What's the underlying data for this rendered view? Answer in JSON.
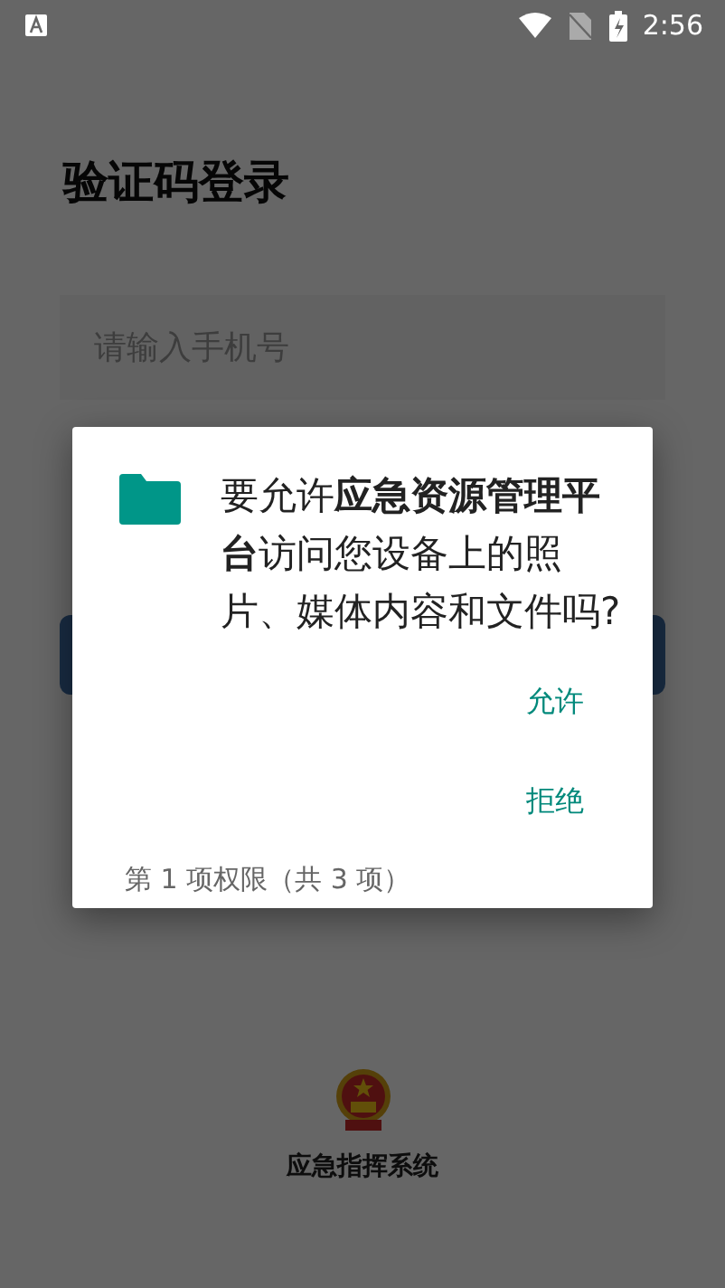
{
  "status_bar": {
    "time": "2:56"
  },
  "login": {
    "title": "验证码登录",
    "phone_field": {
      "placeholder": "请输入手机号"
    },
    "footer_label": "应急指挥系统"
  },
  "dialog": {
    "message": "要允许**应急资源管理平台**访问您设备上的照片、媒体内容和文件吗?",
    "buttons": [
      {
        "label": "允许"
      },
      {
        "label": "拒绝"
      }
    ],
    "counter": "第 1 项权限（共 3 项）"
  }
}
